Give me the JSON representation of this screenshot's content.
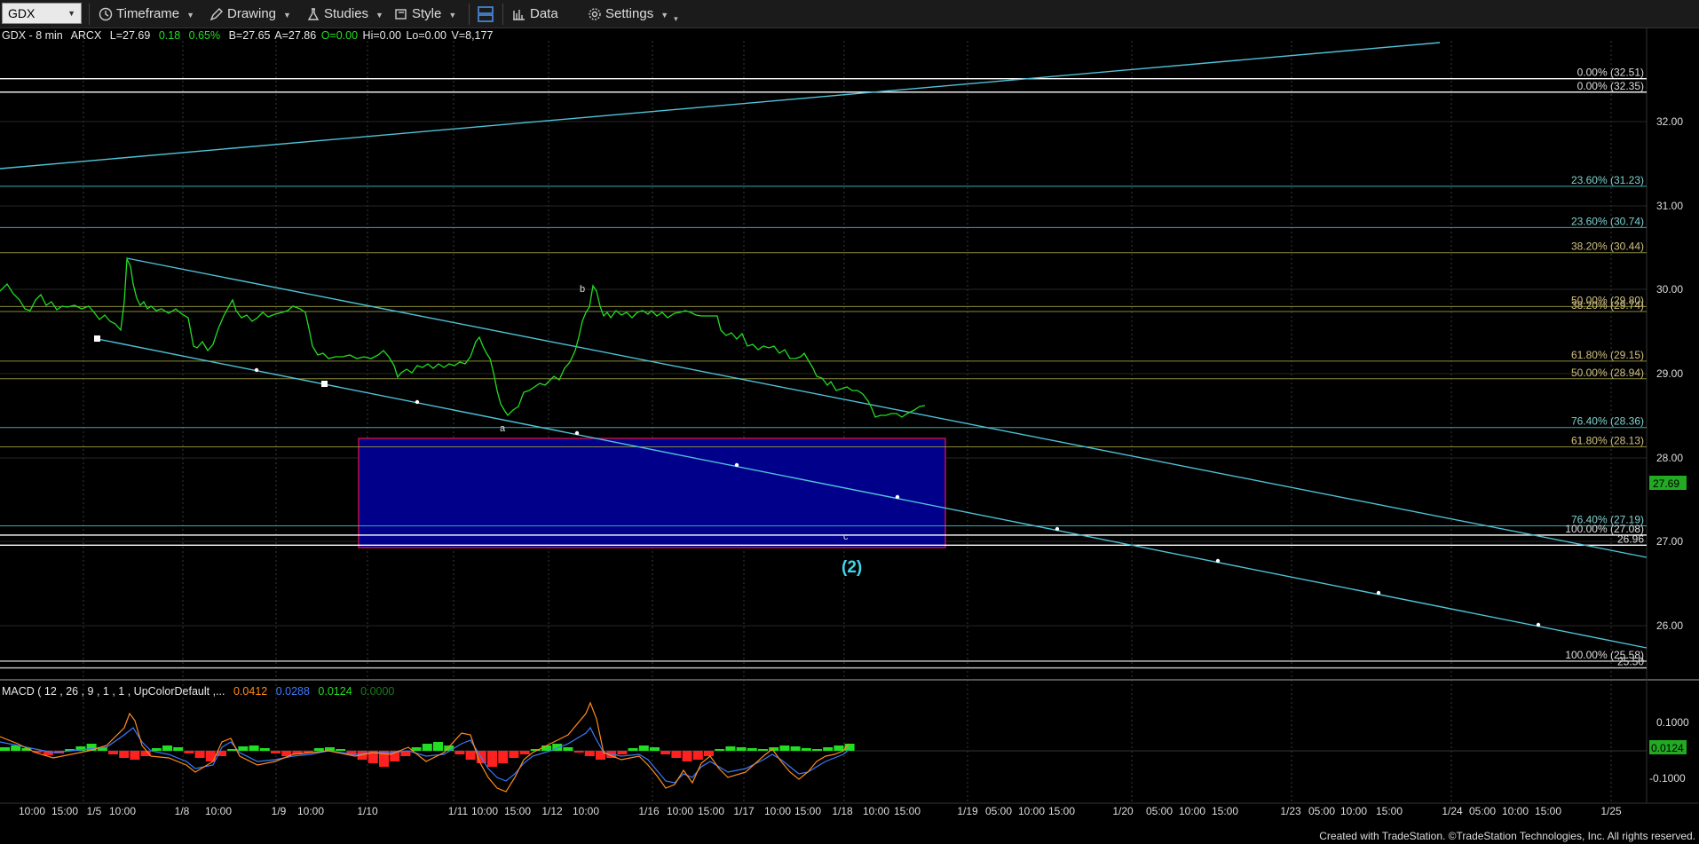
{
  "toolbar": {
    "symbol": "GDX",
    "timeframe": "Timeframe",
    "drawing": "Drawing",
    "studies": "Studies",
    "style": "Style",
    "data": "Data",
    "settings": "Settings"
  },
  "info": {
    "title": "GDX - 8 min",
    "exchange": "ARCX",
    "last": "L=27.69",
    "change": "0.18",
    "change_pct": "0.65%",
    "bid": "B=27.65",
    "ask": "A=27.86",
    "open": "O=0.00",
    "high": "Hi=0.00",
    "low": "Lo=0.00",
    "volume": "V=8,177"
  },
  "macd_info": {
    "label": "MACD ( 12 , 26 , 9 , 1 , 1 , UpColorDefault ,...",
    "v1": "0.0412",
    "v2": "0.0288",
    "v3": "0.0124",
    "v4": "0.0000"
  },
  "colors": {
    "price": "#22dd22",
    "trendline": "#4fc3d9",
    "box_fill": "#00008b",
    "box_border": "#c0104a",
    "fib_text": "#d0c080",
    "macd_orange": "#ff8c1a",
    "macd_blue": "#3b7bff",
    "hist_pos": "#22dd22",
    "hist_neg": "#ff2020",
    "last_price_bg": "#22aa22"
  },
  "price_axis": {
    "ticks": [
      "32.00",
      "31.00",
      "30.00",
      "29.00",
      "28.00",
      "27.00",
      "26.00"
    ],
    "last_price": "27.69"
  },
  "macd_axis": {
    "ticks": [
      "0.1000",
      "-0.1000"
    ],
    "last": "0.0124"
  },
  "fib_levels": [
    {
      "label": "0.00% (32.51)",
      "price": 32.51
    },
    {
      "label": "0.00% (32.35)",
      "price": 32.35
    },
    {
      "label": "23.60% (31.23)",
      "price": 31.23
    },
    {
      "label": "23.60% (30.74)",
      "price": 30.74
    },
    {
      "label": "38.20% (30.44)",
      "price": 30.44
    },
    {
      "label": "50.00% (29.80)",
      "price": 29.8
    },
    {
      "label": "38.20% (29.74)",
      "price": 29.74
    },
    {
      "label": "61.80% (29.15)",
      "price": 29.15
    },
    {
      "label": "50.00% (28.94)",
      "price": 28.94
    },
    {
      "label": "76.40% (28.36)",
      "price": 28.36
    },
    {
      "label": "61.80% (28.13)",
      "price": 28.13
    },
    {
      "label": "76.40% (27.19)",
      "price": 27.19
    },
    {
      "label": "100.00% (27.08)",
      "price": 27.08
    },
    {
      "label": "26.96",
      "price": 26.96
    },
    {
      "label": "100.00% (25.58)",
      "price": 25.58
    },
    {
      "label": "25.50",
      "price": 25.5
    }
  ],
  "wave_labels": {
    "a": "a",
    "b": "b",
    "c": "c",
    "wave2": "(2)"
  },
  "time_axis": [
    "10:00",
    "15:00",
    "1/5",
    "10:00",
    "1/8",
    "10:00",
    "1/9",
    "10:00",
    "1/10",
    "1/11",
    "10:00",
    "15:00",
    "1/12",
    "10:00",
    "1/16",
    "10:00",
    "15:00",
    "1/17",
    "10:00",
    "15:00",
    "1/18",
    "10:00",
    "15:00",
    "1/19",
    "05:00",
    "10:00",
    "15:00",
    "1/20",
    "05:00",
    "10:00",
    "15:00",
    "1/23",
    "05:00",
    "10:00",
    "15:00",
    "1/24",
    "05:00",
    "10:00",
    "15:00",
    "1/25"
  ],
  "footer": "Created with TradeStation. ©TradeStation Technologies, Inc. All rights reserved."
}
